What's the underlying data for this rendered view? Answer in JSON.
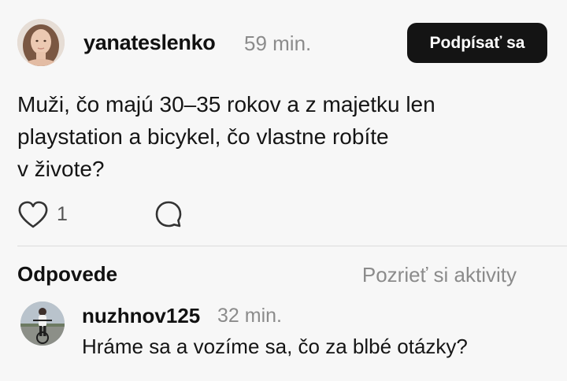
{
  "post": {
    "username": "yanateslenko",
    "time": "59 min.",
    "follow_label": "Podpísať sa",
    "text_lines": [
      "Muži, čo majú 30–35 rokov a z majetku len",
      "playstation a bicykel, čo vlastne robíte",
      "v živote?"
    ],
    "like_count": "1",
    "icons": {
      "like": "heart-icon",
      "comment": "comment-icon"
    }
  },
  "replies_section": {
    "title": "Odpovede",
    "view_activity_label": "Pozrieť si aktivity"
  },
  "replies": [
    {
      "username": "nuzhnov125",
      "time": "32 min.",
      "text": "Hráme sa a vozíme sa, čo za blbé otázky?"
    }
  ],
  "colors": {
    "background": "#f7f7f7",
    "button": "#141414",
    "muted_text": "#8b8b8b"
  }
}
